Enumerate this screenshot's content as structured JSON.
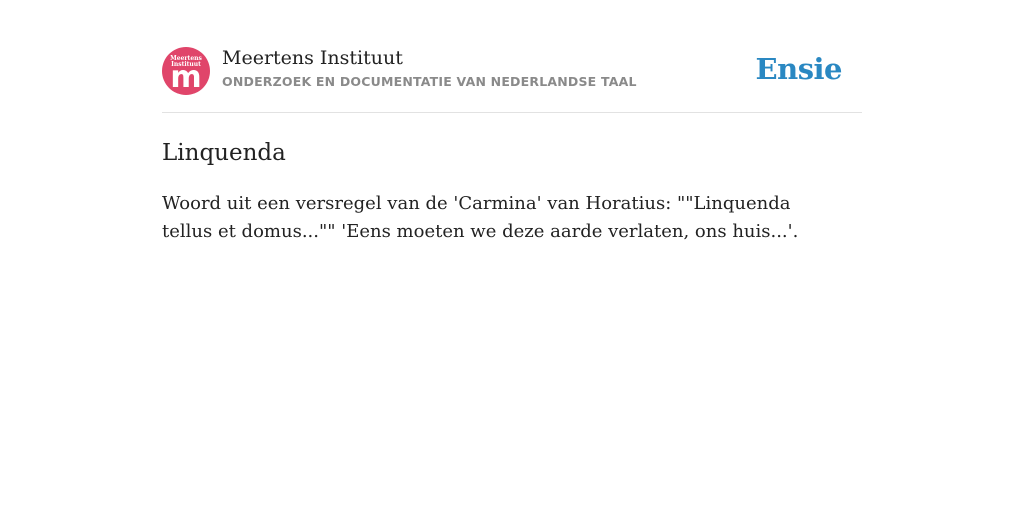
{
  "header": {
    "logo": {
      "line1": "Meertens",
      "line2": "Instituut",
      "letter": "m",
      "icon": "meertens-logo",
      "color": "#e0456a"
    },
    "brand_name": "Meertens Instituut",
    "tagline": "ONDERZOEK EN DOCUMENTATIE VAN NEDERLANDSE TAAL",
    "site_link": "Ensie",
    "site_link_color": "#2a88c2"
  },
  "entry": {
    "title": "Linquenda",
    "definition": "Woord uit een versregel van de 'Carmina' van Horatius: \"\"Linquenda tellus et domus...\"\" 'Eens moeten we deze aarde verlaten, ons huis...'."
  }
}
